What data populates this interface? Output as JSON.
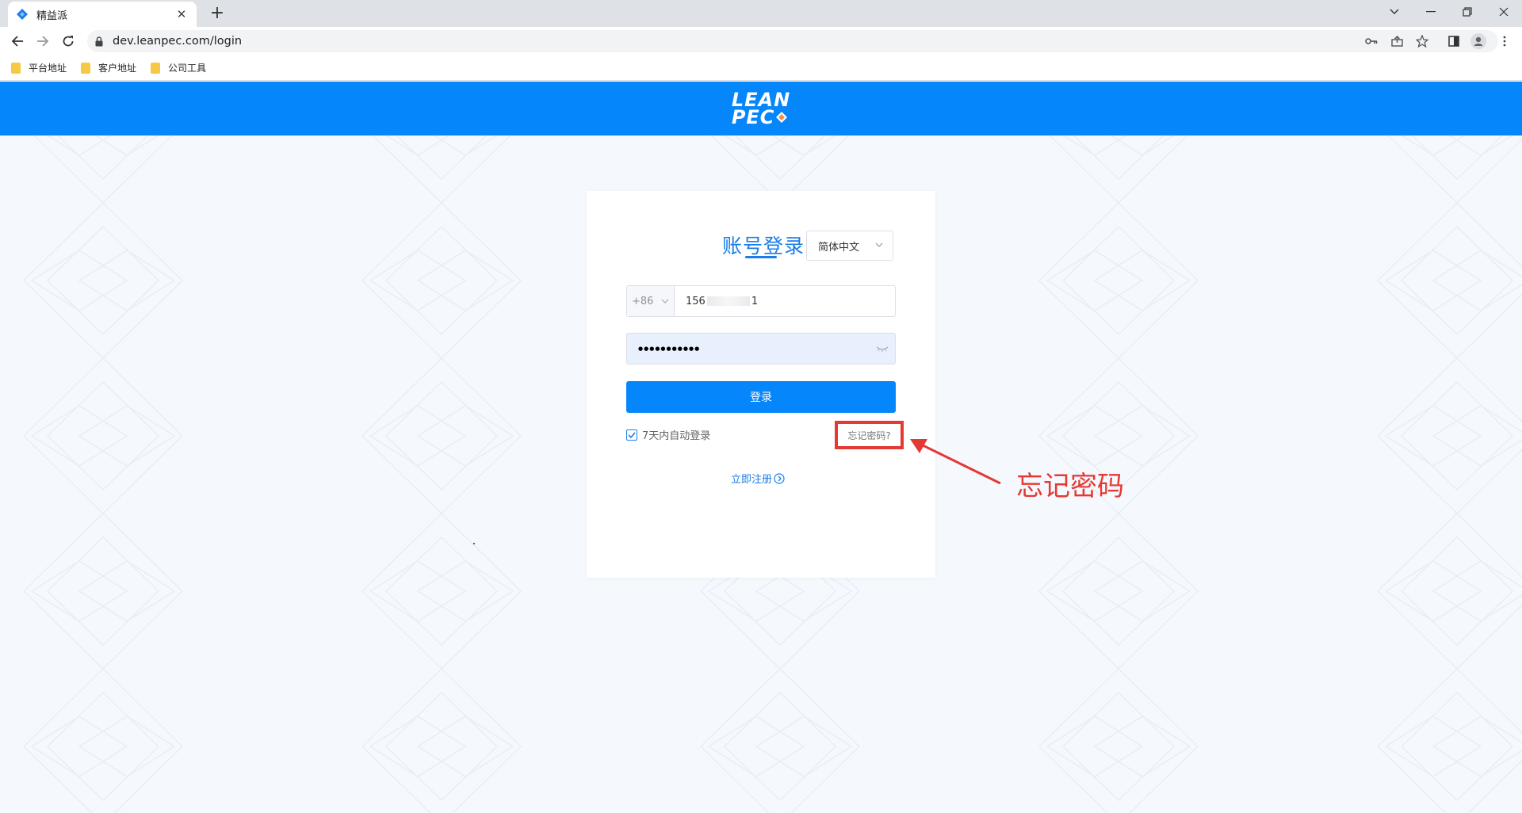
{
  "browser": {
    "tab_title": "精益派",
    "url": "dev.leanpec.com/login",
    "bookmarks": [
      "平台地址",
      "客户地址",
      "公司工具"
    ]
  },
  "header": {
    "logo_line1": "LEAN",
    "logo_line2": "PEC"
  },
  "login": {
    "title": "账号登录",
    "language": "简体中文",
    "country_code": "+86",
    "phone_prefix": "156",
    "phone_suffix": "1",
    "password_mask": "●●●●●●●●●●●",
    "submit_label": "登录",
    "remember_label": "7天内自动登录",
    "forgot_label": "忘记密码?",
    "register_label": "立即注册"
  },
  "annotation": {
    "text": "忘记密码",
    "color": "#e53935"
  },
  "colors": {
    "brand": "#0586fb",
    "link": "#1a7de8"
  }
}
